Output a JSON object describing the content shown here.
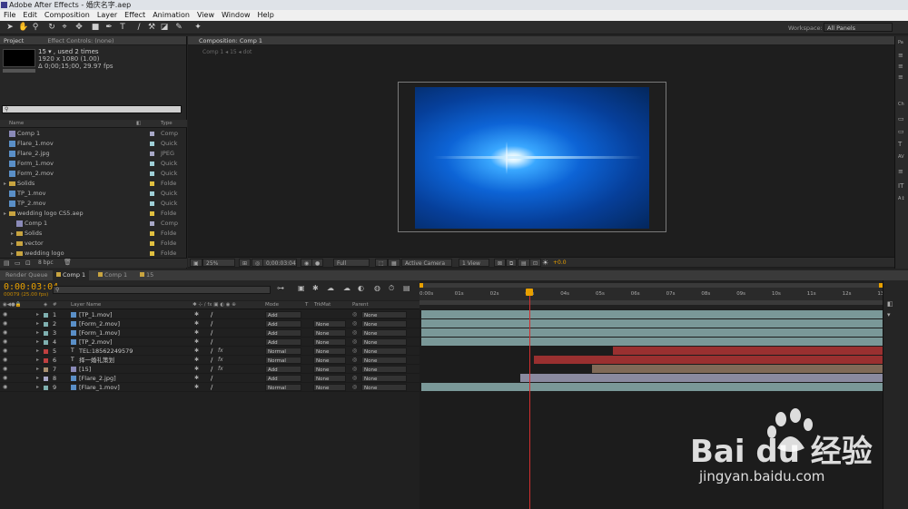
{
  "window": {
    "title": "Adobe After Effects - 婚庆名字.aep"
  },
  "menu": [
    "File",
    "Edit",
    "Composition",
    "Layer",
    "Effect",
    "Animation",
    "View",
    "Window",
    "Help"
  ],
  "toolbar": {
    "workspace_label": "Workspace:",
    "workspace_value": "All Panels"
  },
  "project": {
    "tab_project": "Project",
    "tab_effect_controls": "Effect Controls: (none)",
    "item_name": "15 ▾ , used 2 times",
    "item_res": "1920 x 1080 (1.00)",
    "item_dur": "Δ 0;00;15;00, 29.97 fps",
    "col_name": "Name",
    "col_type": "Type",
    "bpc": "8 bpc",
    "rows": [
      {
        "name": "Comp 1",
        "type": "Comp",
        "kind": "comp",
        "indent": 0,
        "swatch": "#a8a8c8"
      },
      {
        "name": "Flare_1.mov",
        "type": "Quick",
        "kind": "file",
        "indent": 0,
        "swatch": "#9fd0d8"
      },
      {
        "name": "Flare_2.jpg",
        "type": "JPEG",
        "kind": "file",
        "indent": 0,
        "swatch": "#a8a8c8"
      },
      {
        "name": "Form_1.mov",
        "type": "Quick",
        "kind": "file",
        "indent": 0,
        "swatch": "#9fd0d8"
      },
      {
        "name": "Form_2.mov",
        "type": "Quick",
        "kind": "file",
        "indent": 0,
        "swatch": "#9fd0d8"
      },
      {
        "name": "Solids",
        "type": "Folde",
        "kind": "folder",
        "indent": 0,
        "swatch": "#e0c040"
      },
      {
        "name": "TP_1.mov",
        "type": "Quick",
        "kind": "file",
        "indent": 0,
        "swatch": "#9fd0d8"
      },
      {
        "name": "TP_2.mov",
        "type": "Quick",
        "kind": "file",
        "indent": 0,
        "swatch": "#9fd0d8"
      },
      {
        "name": "wedding logo CS5.aep",
        "type": "Folde",
        "kind": "folder",
        "indent": 0,
        "swatch": "#e0c040"
      },
      {
        "name": "Comp 1",
        "type": "Comp",
        "kind": "comp",
        "indent": 1,
        "swatch": "#a8a8c8"
      },
      {
        "name": "Solids",
        "type": "Folde",
        "kind": "folder",
        "indent": 1,
        "swatch": "#e0c040"
      },
      {
        "name": "vector",
        "type": "Folde",
        "kind": "folder",
        "indent": 1,
        "swatch": "#e0c040"
      },
      {
        "name": "wedding logo",
        "type": "Folde",
        "kind": "folder",
        "indent": 1,
        "swatch": "#e0c040"
      }
    ]
  },
  "composition": {
    "tab": "Composition: Comp 1",
    "breadcrumb": "Comp 1  ◂  15  ◂  dot",
    "zoom": "25%",
    "time": "0;00:03:04",
    "resolution": "Full",
    "camera": "Active Camera",
    "view": "1 View",
    "exposure": "+0.0"
  },
  "timeline": {
    "tabs": [
      "Render Queue",
      "Comp 1",
      "Comp 1",
      "15"
    ],
    "timecode": "0:00:03:04",
    "fps": "00079 (25.00 fps)",
    "col_layer_name": "Layer Name",
    "col_mode": "Mode",
    "col_t": "T",
    "col_trkmat": "TrkMat",
    "col_parent": "Parent",
    "ruler": [
      "0:00s",
      "01s",
      "02s",
      "03s",
      "04s",
      "05s",
      "06s",
      "07s",
      "08s",
      "09s",
      "10s",
      "11s",
      "12s",
      "13s"
    ],
    "layers": [
      {
        "num": "1",
        "name": "[TP_1.mov]",
        "mode": "Add",
        "trk": "",
        "parent": "None",
        "label": "#7fb0b0",
        "kind": "file",
        "fx": false,
        "start": 0.0,
        "end": 13.5,
        "barcolor": "#7a9898"
      },
      {
        "num": "2",
        "name": "[Form_2.mov]",
        "mode": "Add",
        "trk": "None",
        "parent": "None",
        "label": "#7fb0b0",
        "kind": "file",
        "fx": false,
        "start": 0.0,
        "end": 13.5,
        "barcolor": "#7a9898"
      },
      {
        "num": "3",
        "name": "[Form_1.mov]",
        "mode": "Add",
        "trk": "None",
        "parent": "None",
        "label": "#7fb0b0",
        "kind": "file",
        "fx": false,
        "start": 0.0,
        "end": 13.5,
        "barcolor": "#7a9898"
      },
      {
        "num": "4",
        "name": "[TP_2.mov]",
        "mode": "Add",
        "trk": "None",
        "parent": "None",
        "label": "#7fb0b0",
        "kind": "file",
        "fx": false,
        "start": 0.0,
        "end": 13.5,
        "barcolor": "#7a9898"
      },
      {
        "num": "5",
        "name": "TEL:18562249579",
        "mode": "Normal",
        "trk": "None",
        "parent": "None",
        "label": "#c04040",
        "kind": "text",
        "fx": true,
        "start": 5.6,
        "end": 13.5,
        "barcolor": "#9a3030"
      },
      {
        "num": "6",
        "name": "择一婚礼策划",
        "mode": "Normal",
        "trk": "None",
        "parent": "None",
        "label": "#c04040",
        "kind": "text",
        "fx": true,
        "start": 3.3,
        "end": 13.5,
        "barcolor": "#9a3030"
      },
      {
        "num": "7",
        "name": "[15]",
        "mode": "Add",
        "trk": "None",
        "parent": "None",
        "label": "#a89070",
        "kind": "comp",
        "fx": true,
        "start": 5.0,
        "end": 13.5,
        "barcolor": "#806a58"
      },
      {
        "num": "8",
        "name": "[Flare_2.jpg]",
        "mode": "Add",
        "trk": "None",
        "parent": "None",
        "label": "#a8a8c8",
        "kind": "file",
        "fx": false,
        "start": 2.9,
        "end": 13.5,
        "barcolor": "#8a8aa0"
      },
      {
        "num": "9",
        "name": "[Flare_1.mov]",
        "mode": "Normal",
        "trk": "None",
        "parent": "None",
        "label": "#7fb0b0",
        "kind": "file",
        "fx": false,
        "start": 0.0,
        "end": 13.5,
        "barcolor": "#7a9898"
      }
    ],
    "duration_s": 13.5,
    "cti_s": 3.16
  },
  "watermark": {
    "brand": "Bai du 经验",
    "url": "jingyan.baidu.com"
  }
}
